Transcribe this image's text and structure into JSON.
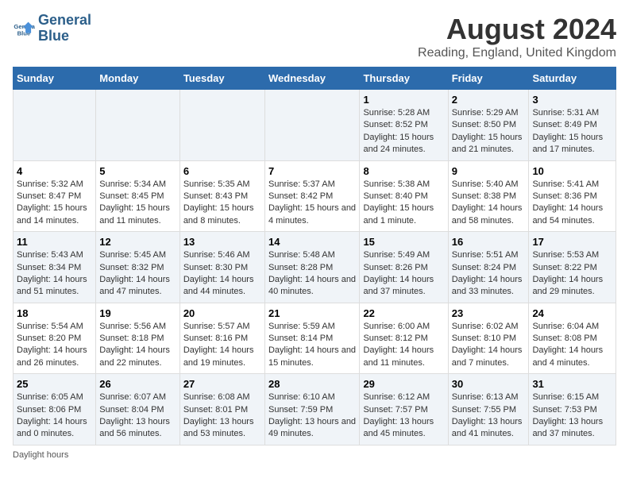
{
  "logo": {
    "line1": "General",
    "line2": "Blue"
  },
  "title": "August 2024",
  "subtitle": "Reading, England, United Kingdom",
  "days_of_week": [
    "Sunday",
    "Monday",
    "Tuesday",
    "Wednesday",
    "Thursday",
    "Friday",
    "Saturday"
  ],
  "footer": "Daylight hours",
  "weeks": [
    [
      {
        "day": "",
        "info": ""
      },
      {
        "day": "",
        "info": ""
      },
      {
        "day": "",
        "info": ""
      },
      {
        "day": "",
        "info": ""
      },
      {
        "day": "1",
        "info": "Sunrise: 5:28 AM\nSunset: 8:52 PM\nDaylight: 15 hours and 24 minutes."
      },
      {
        "day": "2",
        "info": "Sunrise: 5:29 AM\nSunset: 8:50 PM\nDaylight: 15 hours and 21 minutes."
      },
      {
        "day": "3",
        "info": "Sunrise: 5:31 AM\nSunset: 8:49 PM\nDaylight: 15 hours and 17 minutes."
      }
    ],
    [
      {
        "day": "4",
        "info": "Sunrise: 5:32 AM\nSunset: 8:47 PM\nDaylight: 15 hours and 14 minutes."
      },
      {
        "day": "5",
        "info": "Sunrise: 5:34 AM\nSunset: 8:45 PM\nDaylight: 15 hours and 11 minutes."
      },
      {
        "day": "6",
        "info": "Sunrise: 5:35 AM\nSunset: 8:43 PM\nDaylight: 15 hours and 8 minutes."
      },
      {
        "day": "7",
        "info": "Sunrise: 5:37 AM\nSunset: 8:42 PM\nDaylight: 15 hours and 4 minutes."
      },
      {
        "day": "8",
        "info": "Sunrise: 5:38 AM\nSunset: 8:40 PM\nDaylight: 15 hours and 1 minute."
      },
      {
        "day": "9",
        "info": "Sunrise: 5:40 AM\nSunset: 8:38 PM\nDaylight: 14 hours and 58 minutes."
      },
      {
        "day": "10",
        "info": "Sunrise: 5:41 AM\nSunset: 8:36 PM\nDaylight: 14 hours and 54 minutes."
      }
    ],
    [
      {
        "day": "11",
        "info": "Sunrise: 5:43 AM\nSunset: 8:34 PM\nDaylight: 14 hours and 51 minutes."
      },
      {
        "day": "12",
        "info": "Sunrise: 5:45 AM\nSunset: 8:32 PM\nDaylight: 14 hours and 47 minutes."
      },
      {
        "day": "13",
        "info": "Sunrise: 5:46 AM\nSunset: 8:30 PM\nDaylight: 14 hours and 44 minutes."
      },
      {
        "day": "14",
        "info": "Sunrise: 5:48 AM\nSunset: 8:28 PM\nDaylight: 14 hours and 40 minutes."
      },
      {
        "day": "15",
        "info": "Sunrise: 5:49 AM\nSunset: 8:26 PM\nDaylight: 14 hours and 37 minutes."
      },
      {
        "day": "16",
        "info": "Sunrise: 5:51 AM\nSunset: 8:24 PM\nDaylight: 14 hours and 33 minutes."
      },
      {
        "day": "17",
        "info": "Sunrise: 5:53 AM\nSunset: 8:22 PM\nDaylight: 14 hours and 29 minutes."
      }
    ],
    [
      {
        "day": "18",
        "info": "Sunrise: 5:54 AM\nSunset: 8:20 PM\nDaylight: 14 hours and 26 minutes."
      },
      {
        "day": "19",
        "info": "Sunrise: 5:56 AM\nSunset: 8:18 PM\nDaylight: 14 hours and 22 minutes."
      },
      {
        "day": "20",
        "info": "Sunrise: 5:57 AM\nSunset: 8:16 PM\nDaylight: 14 hours and 19 minutes."
      },
      {
        "day": "21",
        "info": "Sunrise: 5:59 AM\nSunset: 8:14 PM\nDaylight: 14 hours and 15 minutes."
      },
      {
        "day": "22",
        "info": "Sunrise: 6:00 AM\nSunset: 8:12 PM\nDaylight: 14 hours and 11 minutes."
      },
      {
        "day": "23",
        "info": "Sunrise: 6:02 AM\nSunset: 8:10 PM\nDaylight: 14 hours and 7 minutes."
      },
      {
        "day": "24",
        "info": "Sunrise: 6:04 AM\nSunset: 8:08 PM\nDaylight: 14 hours and 4 minutes."
      }
    ],
    [
      {
        "day": "25",
        "info": "Sunrise: 6:05 AM\nSunset: 8:06 PM\nDaylight: 14 hours and 0 minutes."
      },
      {
        "day": "26",
        "info": "Sunrise: 6:07 AM\nSunset: 8:04 PM\nDaylight: 13 hours and 56 minutes."
      },
      {
        "day": "27",
        "info": "Sunrise: 6:08 AM\nSunset: 8:01 PM\nDaylight: 13 hours and 53 minutes."
      },
      {
        "day": "28",
        "info": "Sunrise: 6:10 AM\nSunset: 7:59 PM\nDaylight: 13 hours and 49 minutes."
      },
      {
        "day": "29",
        "info": "Sunrise: 6:12 AM\nSunset: 7:57 PM\nDaylight: 13 hours and 45 minutes."
      },
      {
        "day": "30",
        "info": "Sunrise: 6:13 AM\nSunset: 7:55 PM\nDaylight: 13 hours and 41 minutes."
      },
      {
        "day": "31",
        "info": "Sunrise: 6:15 AM\nSunset: 7:53 PM\nDaylight: 13 hours and 37 minutes."
      }
    ]
  ]
}
